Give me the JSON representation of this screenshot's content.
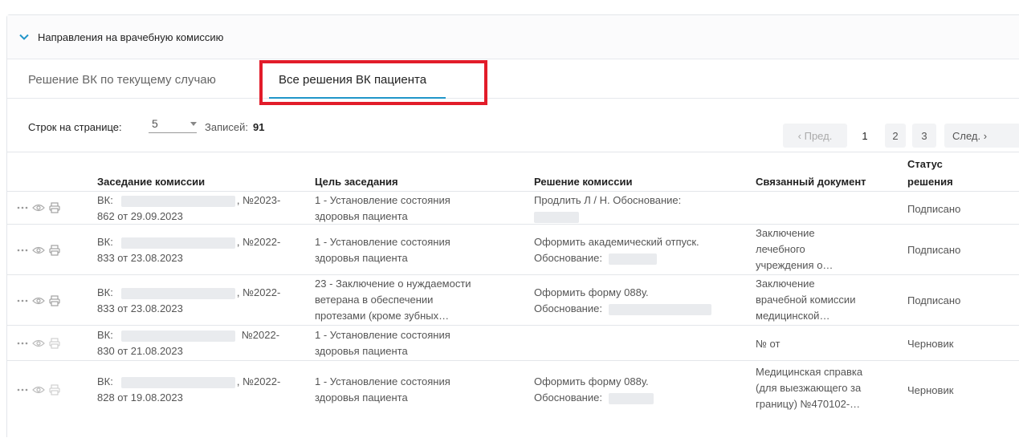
{
  "section": {
    "title": "Направления на врачебную комиссию"
  },
  "tabs": [
    {
      "label": "Решение ВК по текущему случаю"
    },
    {
      "label": "Все решения ВК пациента"
    }
  ],
  "toolbar": {
    "rows_label": "Строк на странице:",
    "rows_value": "5",
    "records_label": "Записей:",
    "records_count": "91"
  },
  "pagination": {
    "prev": "‹ Пред.",
    "pages": [
      "1",
      "2",
      "3"
    ],
    "current": "1",
    "next": "След. ›"
  },
  "table": {
    "headers": {
      "meeting": "Заседание комиссии",
      "goal": "Цель заседания",
      "decision": "Решение комиссии",
      "document": "Связанный документ",
      "status_line1": "Статус",
      "status_line2": "решения"
    },
    "rows": [
      {
        "meeting_prefix": "ВК:",
        "meeting_no": ", №2023-",
        "meeting_line2": "862 от 29.09.2023",
        "goal_line1": "1 - Установление состояния",
        "goal_line2": "здоровья пациента",
        "goal_line3": "",
        "decision_line1": "Продлить Л / Н. Обоснование:",
        "decision_line2": "",
        "document_line1": "",
        "document_line2": "",
        "document_line3": "",
        "status": "Подписано"
      },
      {
        "meeting_prefix": "ВК:",
        "meeting_no": ", №2022-",
        "meeting_line2": "833 от 23.08.2023",
        "goal_line1": "1 - Установление состояния",
        "goal_line2": "здоровья пациента",
        "goal_line3": "",
        "decision_line1": "Оформить академический отпуск.",
        "decision_line2": "Обоснование:",
        "document_line1": "Заключение",
        "document_line2": "лечебного",
        "document_line3": "учреждения о…",
        "status": "Подписано"
      },
      {
        "meeting_prefix": "ВК:",
        "meeting_no": ", №2022-",
        "meeting_line2": "833 от 23.08.2023",
        "goal_line1": "23 - Заключение о нуждаемости",
        "goal_line2": "ветерана в обеспечении",
        "goal_line3": "протезами (кроме зубных…",
        "decision_line1": "Оформить форму 088у.",
        "decision_line2": "Обоснование:",
        "document_line1": "Заключение",
        "document_line2": "врачебной комиссии",
        "document_line3": "медицинской…",
        "status": "Подписано"
      },
      {
        "meeting_prefix": "ВК:",
        "meeting_no": "№2022-",
        "meeting_line2": "830 от 21.08.2023",
        "goal_line1": "1 - Установление состояния",
        "goal_line2": "здоровья пациента",
        "goal_line3": "",
        "decision_line1": "",
        "decision_line2": "",
        "document_line1": "№ от",
        "document_line2": "",
        "document_line3": "",
        "status": "Черновик"
      },
      {
        "meeting_prefix": "ВК:",
        "meeting_no": ", №2022-",
        "meeting_line2": "828 от 19.08.2023",
        "goal_line1": "1 - Установление состояния",
        "goal_line2": "здоровья пациента",
        "goal_line3": "",
        "decision_line1": "Оформить форму 088у.",
        "decision_line2": "Обоснование:",
        "document_line1": "Медицинская справка",
        "document_line2": "(для выезжающего за",
        "document_line3": "границу) №470102-…",
        "status": "Черновик"
      }
    ]
  },
  "colors": {
    "accent": "#2196c9",
    "highlight": "#e21c2a"
  }
}
